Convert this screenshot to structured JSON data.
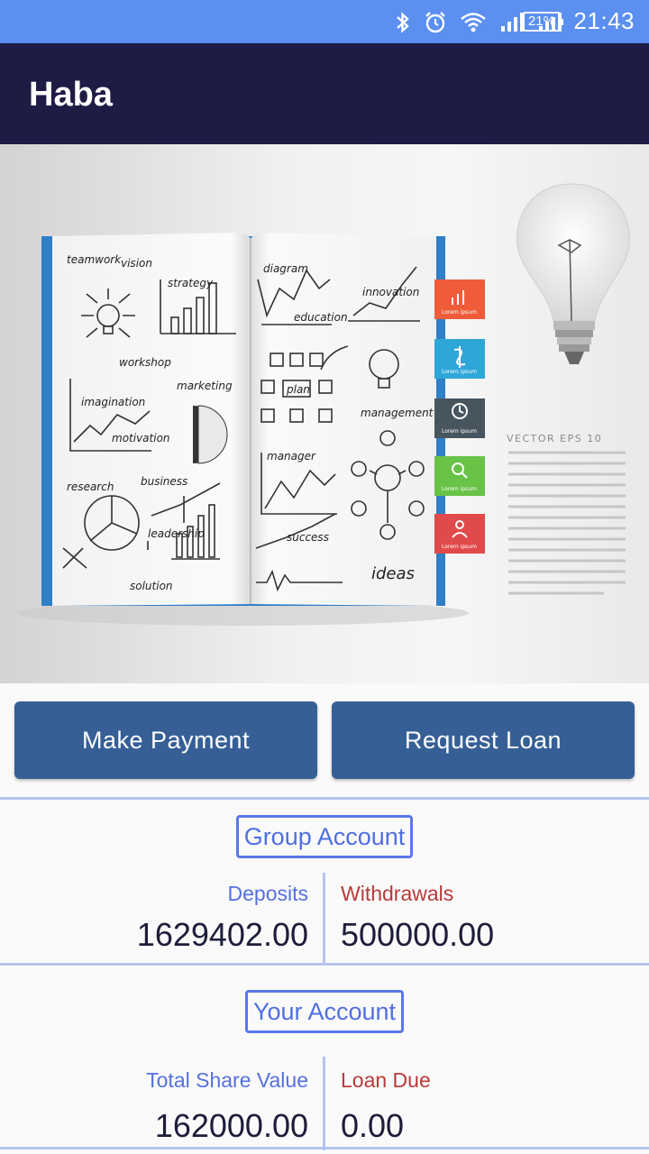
{
  "status_bar": {
    "time": "21:43",
    "battery": "21%",
    "icons": [
      "bluetooth-icon",
      "alarm-icon",
      "wifi-icon",
      "signal-icon",
      "signal-icon"
    ]
  },
  "app_bar": {
    "title": "Haba"
  },
  "hero": {
    "book_words": [
      "teamwork",
      "vision",
      "strategy",
      "workshop",
      "imagination",
      "motivation",
      "marketing",
      "research",
      "business",
      "leadership",
      "solution",
      "diagram",
      "education",
      "innovation",
      "plan",
      "management",
      "manager",
      "success",
      "ideas"
    ],
    "side_text_title": "VECTOR EPS 10",
    "tab_label": "Lorem ipsum",
    "tab_colors": [
      "#ef5c3a",
      "#2ea6d8",
      "#47555f",
      "#68c347",
      "#e04a4a"
    ]
  },
  "actions": {
    "make_payment": "Make Payment",
    "request_loan": "Request Loan",
    "button_color": "#365f96"
  },
  "group_account": {
    "title": "Group Account",
    "deposits_label": "Deposits",
    "deposits_value": "1629402.00",
    "withdrawals_label": "Withdrawals",
    "withdrawals_value": "500000.00"
  },
  "your_account": {
    "title": "Your Account",
    "share_label": "Total Share Value",
    "share_value": "162000.00",
    "loan_label": "Loan Due",
    "loan_value": "0.00"
  }
}
